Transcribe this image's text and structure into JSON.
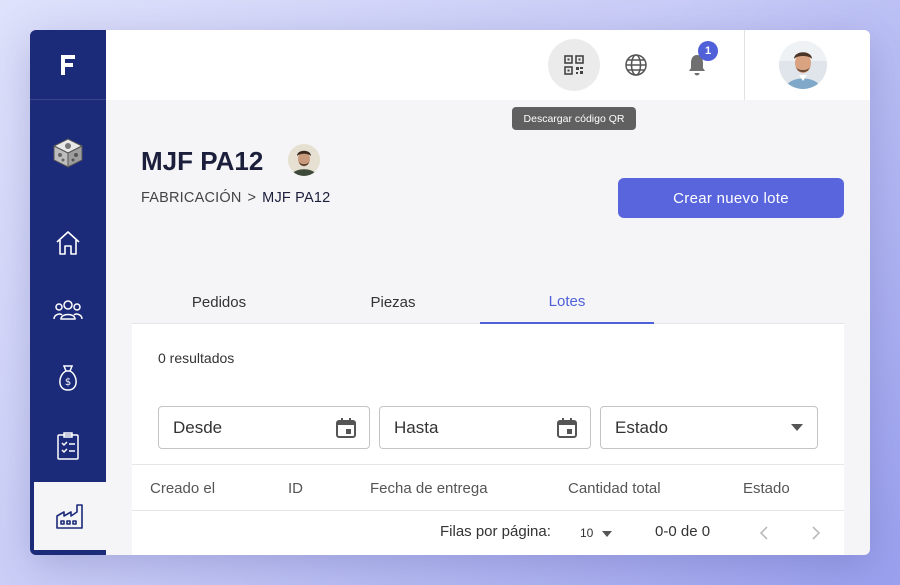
{
  "sidebar": {
    "logo": "F",
    "items": [
      {
        "icon": "3d-printer-icon"
      },
      {
        "icon": "home-icon"
      },
      {
        "icon": "users-icon"
      },
      {
        "icon": "money-bag-icon"
      },
      {
        "icon": "clipboard-icon"
      },
      {
        "icon": "factory-icon",
        "active": true
      }
    ]
  },
  "topbar": {
    "qr_icon": "qr-code-icon",
    "tooltip": "Descargar código QR",
    "notification_count": "1"
  },
  "page": {
    "title": "MJF PA12",
    "breadcrumb": {
      "parent": "FABRICACIÓN",
      "separator": ">",
      "current": "MJF PA12"
    },
    "create_button": "Crear nuevo lote"
  },
  "tabs": [
    {
      "label": "Pedidos"
    },
    {
      "label": "Piezas"
    },
    {
      "label": "Lotes",
      "active": true
    }
  ],
  "panel": {
    "results": "0 resultados",
    "filters": {
      "from": "Desde",
      "to": "Hasta",
      "status": "Estado"
    },
    "columns": [
      "Creado el",
      "ID",
      "Fecha de entrega",
      "Cantidad total",
      "Estado"
    ],
    "pagination": {
      "rows_label": "Filas por página:",
      "rows_value": "10",
      "range": "0-0 de 0"
    }
  },
  "colors": {
    "sidebar": "#1c2a7a",
    "accent": "#5865dc",
    "background": "#f5f5f7"
  }
}
